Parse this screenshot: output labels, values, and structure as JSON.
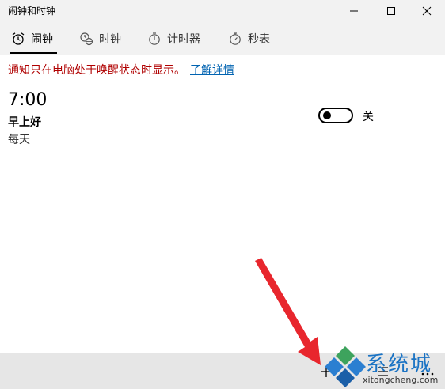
{
  "window": {
    "title": "闹钟和时钟"
  },
  "tabs": [
    {
      "label": "闹钟",
      "icon": "alarm-clock-icon",
      "selected": true
    },
    {
      "label": "时钟",
      "icon": "world-clock-icon",
      "selected": false
    },
    {
      "label": "计时器",
      "icon": "timer-icon",
      "selected": false
    },
    {
      "label": "秒表",
      "icon": "stopwatch-icon",
      "selected": false
    }
  ],
  "notice": {
    "message": "通知只在电脑处于唤醒状态时显示。",
    "link": "了解详情",
    "message_color": "#b00000",
    "link_color": "#0063b1"
  },
  "alarms": [
    {
      "time": "7:00",
      "name": "早上好",
      "repeat": "每天",
      "enabled": false,
      "toggle_label": "关"
    }
  ],
  "watermark": {
    "text": "系统城",
    "url": "xitongcheng.com"
  },
  "colors": {
    "chrome_bg": "#f2f2f2",
    "commandbar_bg": "#e6e6e6",
    "annotation_arrow": "#e8262d"
  }
}
